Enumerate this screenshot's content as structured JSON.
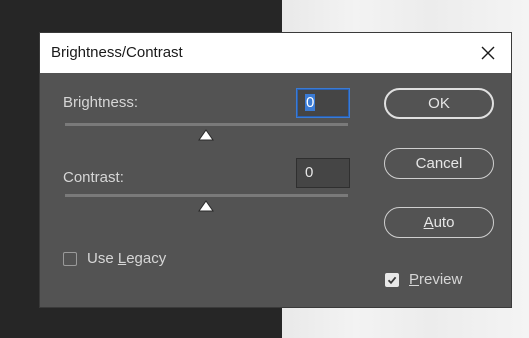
{
  "dialog": {
    "title": "Brightness/Contrast",
    "brightness": {
      "label": "Brightness:",
      "value": "0",
      "slider_fraction": 0.5
    },
    "contrast": {
      "label": "Contrast:",
      "value": "0",
      "slider_fraction": 0.5
    },
    "buttons": {
      "ok": "OK",
      "cancel": "Cancel",
      "auto_prefix": "A",
      "auto_rest": "uto"
    },
    "use_legacy": {
      "prefix": "Use ",
      "mnemonic": "L",
      "rest": "egacy",
      "checked": false
    },
    "preview": {
      "mnemonic": "P",
      "rest": "review",
      "checked": true
    }
  },
  "icons": {
    "close": "close-icon",
    "slider_thumb": "triangle-up-icon",
    "check": "checkmark-icon"
  },
  "colors": {
    "dialog_bg": "#535353",
    "focus_blue": "#3a7bd5"
  }
}
